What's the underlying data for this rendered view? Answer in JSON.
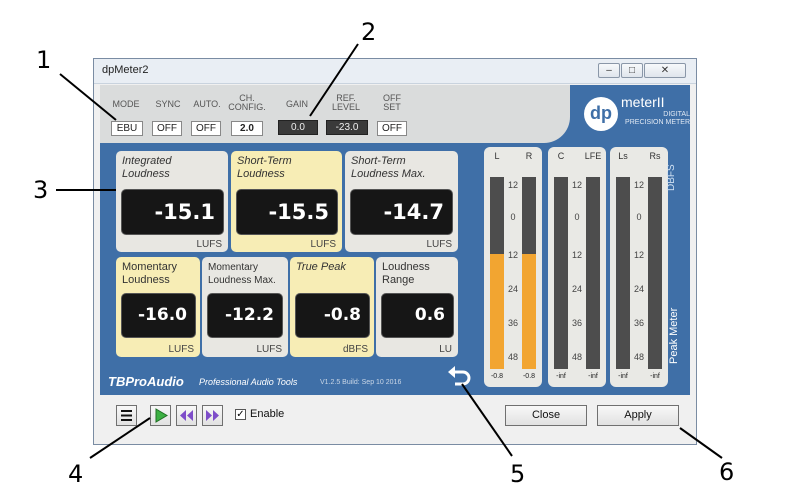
{
  "window": {
    "title": "dpMeter2",
    "controls": [
      "minimize-icon",
      "maximize-icon",
      "close-icon"
    ]
  },
  "params": [
    {
      "label": "MODE",
      "value": "EBU"
    },
    {
      "label": "SYNC",
      "value": "OFF"
    },
    {
      "label": "AUTO.",
      "value": "OFF"
    },
    {
      "label": "CH. CONFIG.",
      "value": "2.0"
    },
    {
      "label": "GAIN",
      "value": "0.0"
    },
    {
      "label": "REF. LEVEL",
      "value": "-23.0"
    },
    {
      "label": "OFF SET",
      "value": "OFF"
    }
  ],
  "logo": {
    "mark": "dp",
    "name": "meterII",
    "tagline": "DIGITAL PRECISION METER"
  },
  "tiles": [
    {
      "label": "Integrated Loudness",
      "value": "-15.1",
      "unit": "LUFS",
      "highlight": false
    },
    {
      "label": "Short-Term Loudness",
      "value": "-15.5",
      "unit": "LUFS",
      "highlight": true
    },
    {
      "label": "Short-Term Loudness Max.",
      "value": "-14.7",
      "unit": "LUFS",
      "highlight": false
    },
    {
      "label": "Momentary Loudness",
      "value": "-16.0",
      "unit": "LUFS",
      "highlight": true
    },
    {
      "label": "Momentary Loudness Max.",
      "value": "-12.2",
      "unit": "LUFS",
      "highlight": false
    },
    {
      "label": "True Peak",
      "value": "-0.8",
      "unit": "dBFS",
      "highlight": true
    },
    {
      "label": "Loudness Range",
      "value": "0.6",
      "unit": "LU",
      "highlight": false
    }
  ],
  "meters": {
    "scale": [
      "12",
      "0",
      "12",
      "24",
      "36",
      "48"
    ],
    "groups": [
      {
        "channels": [
          {
            "name": "L",
            "level": 0.6,
            "peak": "-0.8"
          },
          {
            "name": "R",
            "level": 0.6,
            "peak": "-0.8"
          }
        ]
      },
      {
        "channels": [
          {
            "name": "C",
            "level": 0,
            "peak": "-inf"
          },
          {
            "name": "LFE",
            "level": 0,
            "peak": "-inf"
          }
        ]
      },
      {
        "channels": [
          {
            "name": "Ls",
            "level": 0,
            "peak": "-inf"
          },
          {
            "name": "Rs",
            "level": 0,
            "peak": "-inf"
          }
        ]
      }
    ],
    "unit_label": "DBFS",
    "side_label": "Peak Meter",
    "fill_color": "#f2a531"
  },
  "brand": {
    "name": "TBProAudio",
    "tagline": "Professional Audio Tools",
    "version": "V1.2.5 Build: Sep 10 2016"
  },
  "buttons": {
    "menu_icon": "hamburger-menu-icon",
    "play_icon": "play-icon",
    "prev_icon": "previous-preset-icon",
    "next_icon": "next-preset-icon",
    "enable_label": "Enable",
    "enable_checked": true,
    "undo_icon": "undo-arrow-icon",
    "close_label": "Close",
    "apply_label": "Apply"
  },
  "callouts": [
    "1",
    "2",
    "3",
    "4",
    "5",
    "6"
  ],
  "colors": {
    "panel_blue": "#3f6fa7",
    "highlight_yellow": "#f7edb5",
    "play_green": "#3cb043"
  }
}
